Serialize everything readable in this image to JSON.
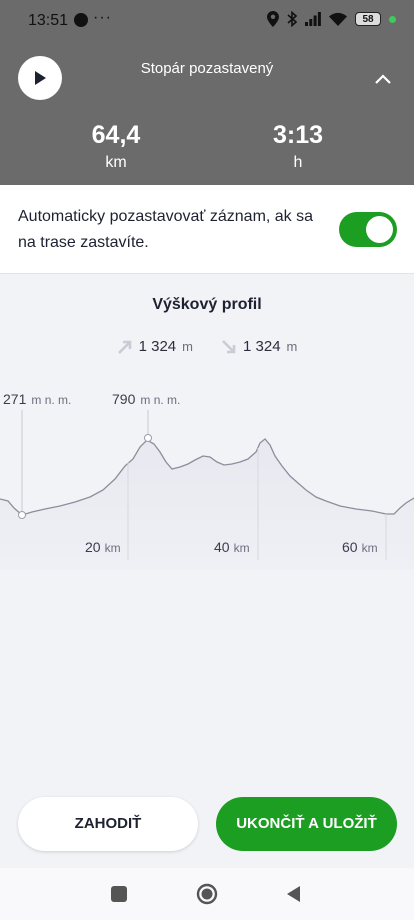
{
  "status_bar": {
    "time": "13:51",
    "overflow": "···",
    "battery": "58"
  },
  "tracker": {
    "title": "Stopár pozastavený",
    "distance_value": "64,4",
    "distance_unit": "km",
    "time_value": "3:13",
    "time_unit": "h"
  },
  "auto_pause": {
    "label": "Automaticky pozastavovať záznam, ak sa na trase zastavíte.",
    "enabled": true
  },
  "elevation_profile": {
    "title": "Výškový profil",
    "ascent_value": "1 324",
    "ascent_unit": "m",
    "descent_value": "1 324",
    "descent_unit": "m",
    "min_label_value": "271",
    "min_label_unit": "m n. m.",
    "max_label_value": "790",
    "max_label_unit": "m n. m.",
    "x_ticks": [
      {
        "value": "20",
        "unit": "km"
      },
      {
        "value": "40",
        "unit": "km"
      },
      {
        "value": "60",
        "unit": "km"
      }
    ]
  },
  "actions": {
    "discard_label": "ZAHODIŤ",
    "save_label": "UKONČIŤ A ULOŽIŤ"
  },
  "navigation": [
    "recents-icon",
    "home-icon",
    "back-icon"
  ]
}
